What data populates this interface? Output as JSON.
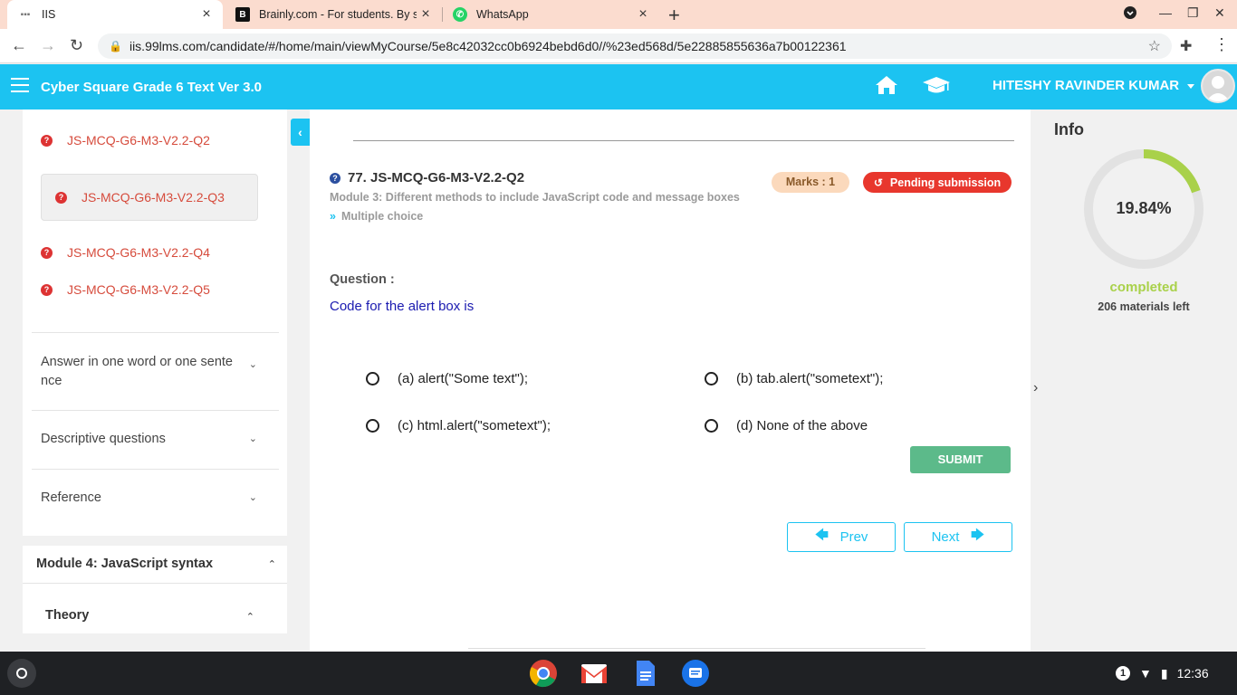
{
  "browser": {
    "tabs": [
      {
        "title": "IIS",
        "active": true
      },
      {
        "title": "Brainly.com - For students. By st",
        "active": false
      },
      {
        "title": "WhatsApp",
        "active": false
      }
    ],
    "url": "iis.99lms.com/candidate/#/home/main/viewMyCourse/5e8c42032cc0b6924bebd6d0//%23ed568d/5e22885855636a7b00122361"
  },
  "header": {
    "app_title": "Cyber Square Grade 6 Text Ver 3.0",
    "user_name": "HITESHY RAVINDER KUMAR",
    "accent_color": "#1cc3f1"
  },
  "sidebar": {
    "question_items": [
      {
        "label": "JS-MCQ-G6-M3-V2.2-Q2"
      },
      {
        "label": "JS-MCQ-G6-M3-V2.2-Q3"
      },
      {
        "label": "JS-MCQ-G6-M3-V2.2-Q4"
      },
      {
        "label": "JS-MCQ-G6-M3-V2.2-Q5"
      }
    ],
    "sections": [
      {
        "label": "Answer in one word or one sente nce"
      },
      {
        "label": "Descriptive questions"
      },
      {
        "label": "Reference"
      }
    ],
    "module4": "Module 4: JavaScript syntax",
    "theory": "Theory"
  },
  "question": {
    "title": "77. JS-MCQ-G6-M3-V2.2-Q2",
    "module": "Module 3: Different methods to include JavaScript code and message boxes",
    "type": "Multiple choice",
    "marks": "Marks : 1",
    "status": "Pending submission",
    "label": "Question :",
    "text": "Code for the alert box is",
    "options": [
      {
        "text": "(a) alert(\"Some text\");"
      },
      {
        "text": "(b) tab.alert(\"sometext\");"
      },
      {
        "text": "(c) html.alert(\"sometext\");"
      },
      {
        "text": "(d) None of the above"
      }
    ],
    "submit_label": "SUBMIT",
    "prev_label": "Prev",
    "next_label": "Next"
  },
  "info": {
    "title": "Info",
    "progress_percent": "19.84%",
    "progress_fraction": 0.1984,
    "status": "completed",
    "materials_left": "206 materials left"
  },
  "taskbar": {
    "notification_count": "1",
    "time": "12:36"
  }
}
